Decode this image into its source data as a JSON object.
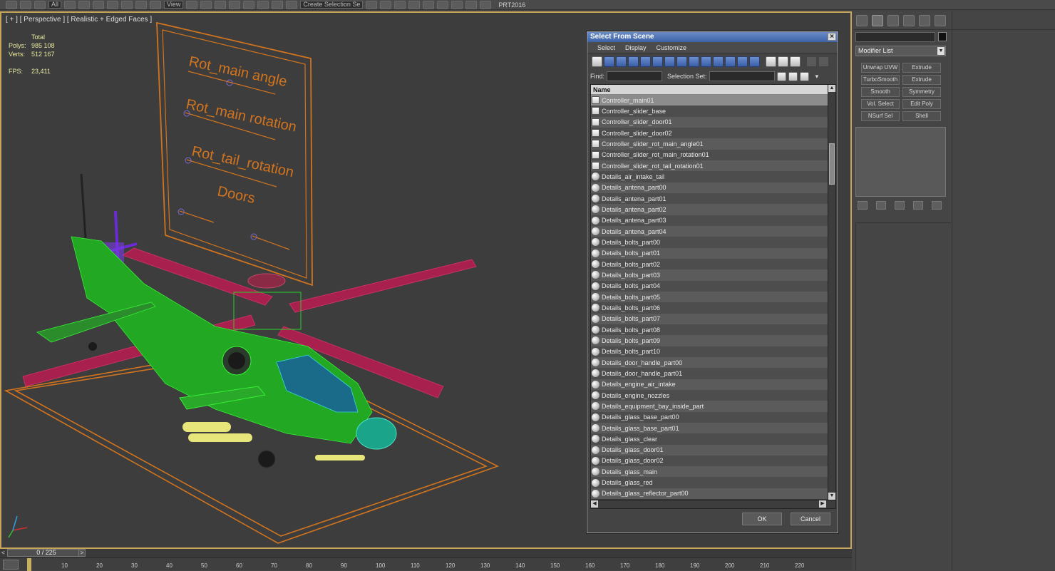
{
  "toolbar": {
    "combo_all": "All",
    "combo_view": "View",
    "selection_set_combo": "Create Selection Se",
    "prt_label": "PRT2016"
  },
  "viewport": {
    "label": "[ + ] [ Perspective ] [ Realistic + Edged Faces ]",
    "stats": {
      "total_label": "Total",
      "polys_label": "Polys:",
      "polys_value": "985 108",
      "verts_label": "Verts:",
      "verts_value": "512 167",
      "fps_label": "FPS:",
      "fps_value": "23,411"
    },
    "board_labels": [
      "Rot_main angle",
      "Rot_main rotation",
      "Rot_tail_rotation",
      "Doors"
    ],
    "colors": {
      "border_active": "#c8a55a",
      "wire_green": "#22b822",
      "rotor_magenta": "#a8204e",
      "slider_orange": "#d2741e",
      "yellow_parts": "#e6e67a",
      "teal_parts": "#1aa58a"
    }
  },
  "dialog": {
    "title": "Select From Scene",
    "close_glyph": "×",
    "menu": [
      "Select",
      "Display",
      "Customize"
    ],
    "find_label": "Find:",
    "selection_set_label": "Selection Set:",
    "column_name": "Name",
    "items": [
      "Controller_main01",
      "Controller_slider_base",
      "Controller_slider_door01",
      "Controller_slider_door02",
      "Controller_slider_rot_main_angle01",
      "Controller_slider_rot_main_rotation01",
      "Controller_slider_rot_tail_rotation01",
      "Details_air_intake_tail",
      "Details_antena_part00",
      "Details_antena_part01",
      "Details_antena_part02",
      "Details_antena_part03",
      "Details_antena_part04",
      "Details_bolts_part00",
      "Details_bolts_part01",
      "Details_bolts_part02",
      "Details_bolts_part03",
      "Details_bolts_part04",
      "Details_bolts_part05",
      "Details_bolts_part06",
      "Details_bolts_part07",
      "Details_bolts_part08",
      "Details_bolts_part09",
      "Details_bolts_part10",
      "Details_door_handle_part00",
      "Details_door_handle_part01",
      "Details_engine_air_intake",
      "Details_engine_nozzles",
      "Details_equipment_bay_inside_part",
      "Details_glass_base_part00",
      "Details_glass_base_part01",
      "Details_glass_clear",
      "Details_glass_door01",
      "Details_glass_door02",
      "Details_glass_main",
      "Details_glass_red",
      "Details_glass_reflector_part00"
    ],
    "ok_label": "OK",
    "cancel_label": "Cancel"
  },
  "command_panel": {
    "modifier_list_label": "Modifier List",
    "modifier_buttons": [
      "Unwrap UVW",
      "Extrude",
      "TurboSmooth",
      "Extrude",
      "Smooth",
      "Symmetry",
      "Vol. Select",
      "Edit Poly",
      "NSurf Sel",
      "Shell"
    ]
  },
  "timeline": {
    "frame_counter": "0 / 225",
    "ticks": [
      "10",
      "20",
      "30",
      "40",
      "50",
      "60",
      "70",
      "80",
      "90",
      "100",
      "110",
      "120",
      "130",
      "140",
      "150",
      "160",
      "170",
      "180",
      "190",
      "200",
      "210",
      "220"
    ]
  }
}
